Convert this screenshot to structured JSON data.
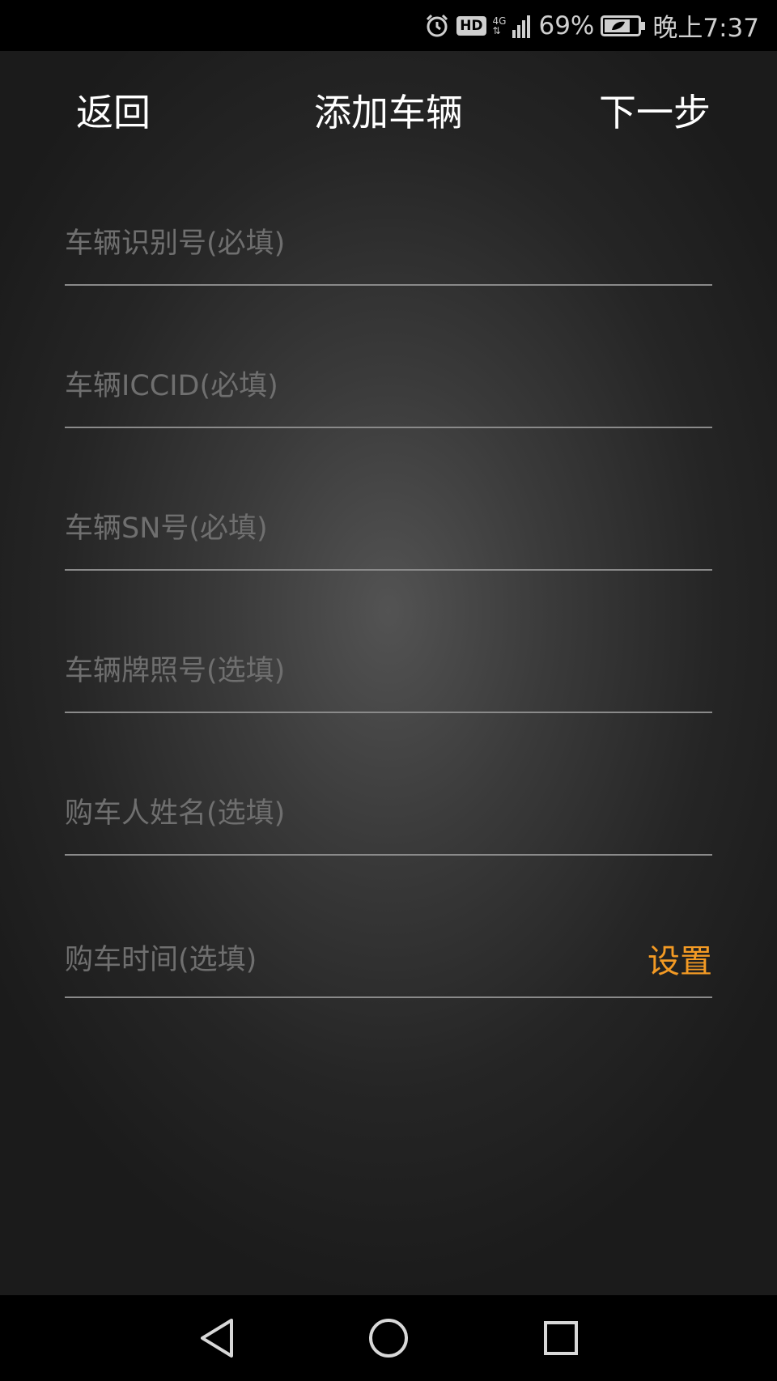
{
  "status_bar": {
    "icons": [
      "alarm-icon",
      "hd-icon",
      "4g-icon",
      "signal-icon",
      "battery-icon"
    ],
    "hd_label": "HD",
    "network_label": "4G",
    "battery_percent": "69%",
    "time": "晚上7:37"
  },
  "header": {
    "back_label": "返回",
    "title": "添加车辆",
    "next_label": "下一步"
  },
  "form": {
    "fields": [
      {
        "placeholder": "车辆识别号(必填)",
        "value": ""
      },
      {
        "placeholder": "车辆ICCID(必填)",
        "value": ""
      },
      {
        "placeholder": "车辆SN号(必填)",
        "value": ""
      },
      {
        "placeholder": "车辆牌照号(选填)",
        "value": ""
      },
      {
        "placeholder": "购车人姓名(选填)",
        "value": ""
      }
    ],
    "purchase_time_label": "购车时间(选填)",
    "set_label": "设置"
  },
  "system_nav": {
    "icons": [
      "back-triangle-icon",
      "home-circle-icon",
      "recents-square-icon"
    ]
  },
  "colors": {
    "accent": "#f39a24",
    "background": "#1b1b1b",
    "divider": "#8a8a8a"
  }
}
